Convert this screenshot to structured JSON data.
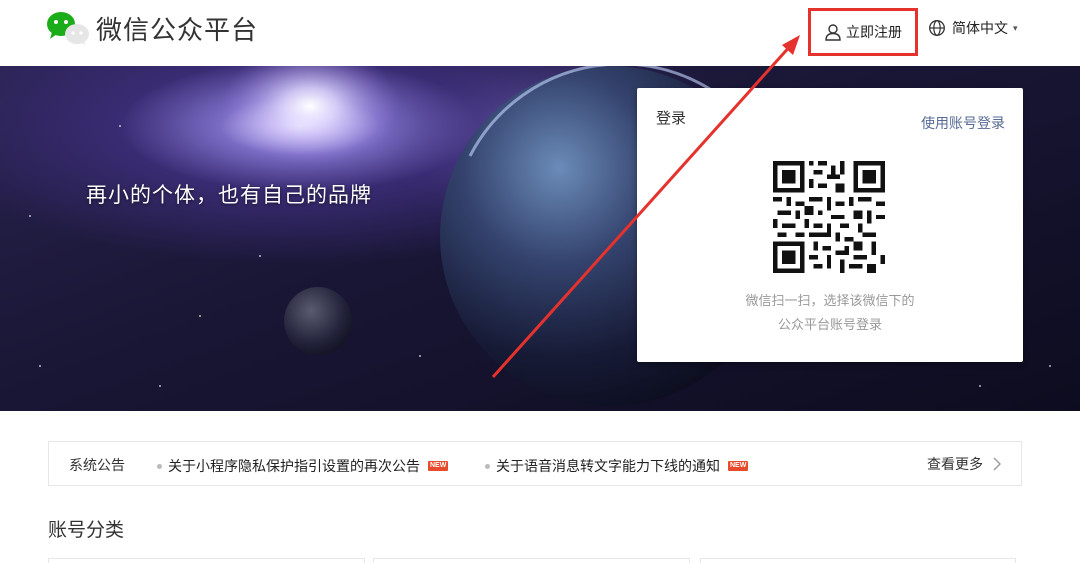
{
  "header": {
    "logo_title": "微信公众平台",
    "register_label": "立即注册",
    "language_label": "简体中文"
  },
  "banner": {
    "slogan": "再小的个体，也有自己的品牌"
  },
  "login": {
    "title": "登录",
    "account_login_link": "使用账号登录",
    "qr_hint_line1": "微信扫一扫，选择该微信下的",
    "qr_hint_line2": "公众平台账号登录"
  },
  "notices": {
    "label": "系统公告",
    "items": [
      {
        "text": "关于小程序隐私保护指引设置的再次公告",
        "badge": "NEW"
      },
      {
        "text": "关于语音消息转文字能力下线的通知",
        "badge": "NEW"
      }
    ],
    "view_more": "查看更多"
  },
  "section": {
    "title": "账号分类"
  },
  "colors": {
    "brand_green": "#1aad19",
    "highlight_red": "#e5322d",
    "link_blue": "#576b95",
    "badge_red": "#e84b2c"
  },
  "icons": {
    "logo": "wechat-logo-icon",
    "register": "user-icon",
    "language": "globe-icon",
    "more": "chevron-right-icon"
  }
}
